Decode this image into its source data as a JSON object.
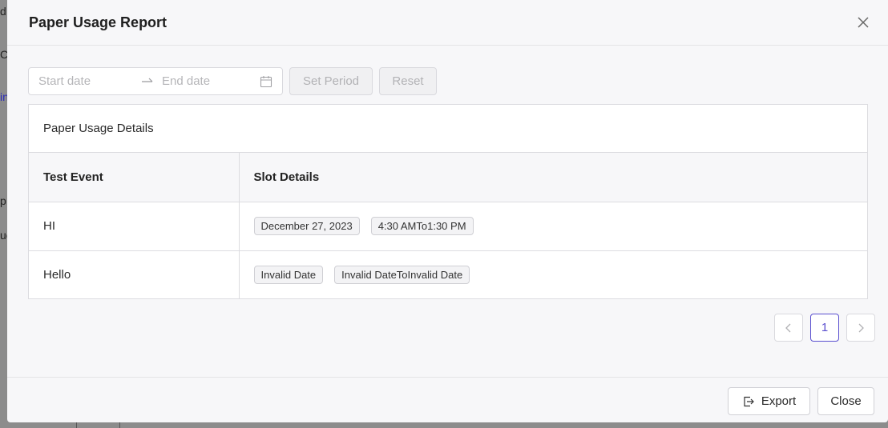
{
  "background": {
    "fragments": [
      "d",
      "Cr",
      "in",
      "p",
      "ue"
    ]
  },
  "modal": {
    "title": "Paper Usage Report"
  },
  "filters": {
    "start_placeholder": "Start date",
    "end_placeholder": "End date",
    "set_period_label": "Set Period",
    "reset_label": "Reset"
  },
  "card": {
    "title": "Paper Usage Details",
    "columns": [
      "Test Event",
      "Slot Details"
    ],
    "rows": [
      {
        "event": "HI",
        "date": "December 27, 2023",
        "time": "4:30 AMTo1:30 PM"
      },
      {
        "event": "Hello",
        "date": "Invalid Date",
        "time": "Invalid DateToInvalid Date"
      }
    ]
  },
  "pagination": {
    "current_page": "1",
    "prev_symbol": "<",
    "next_symbol": ">"
  },
  "footer": {
    "export_label": "Export",
    "close_label": "Close"
  },
  "colors": {
    "accent": "#5a4fcf"
  }
}
